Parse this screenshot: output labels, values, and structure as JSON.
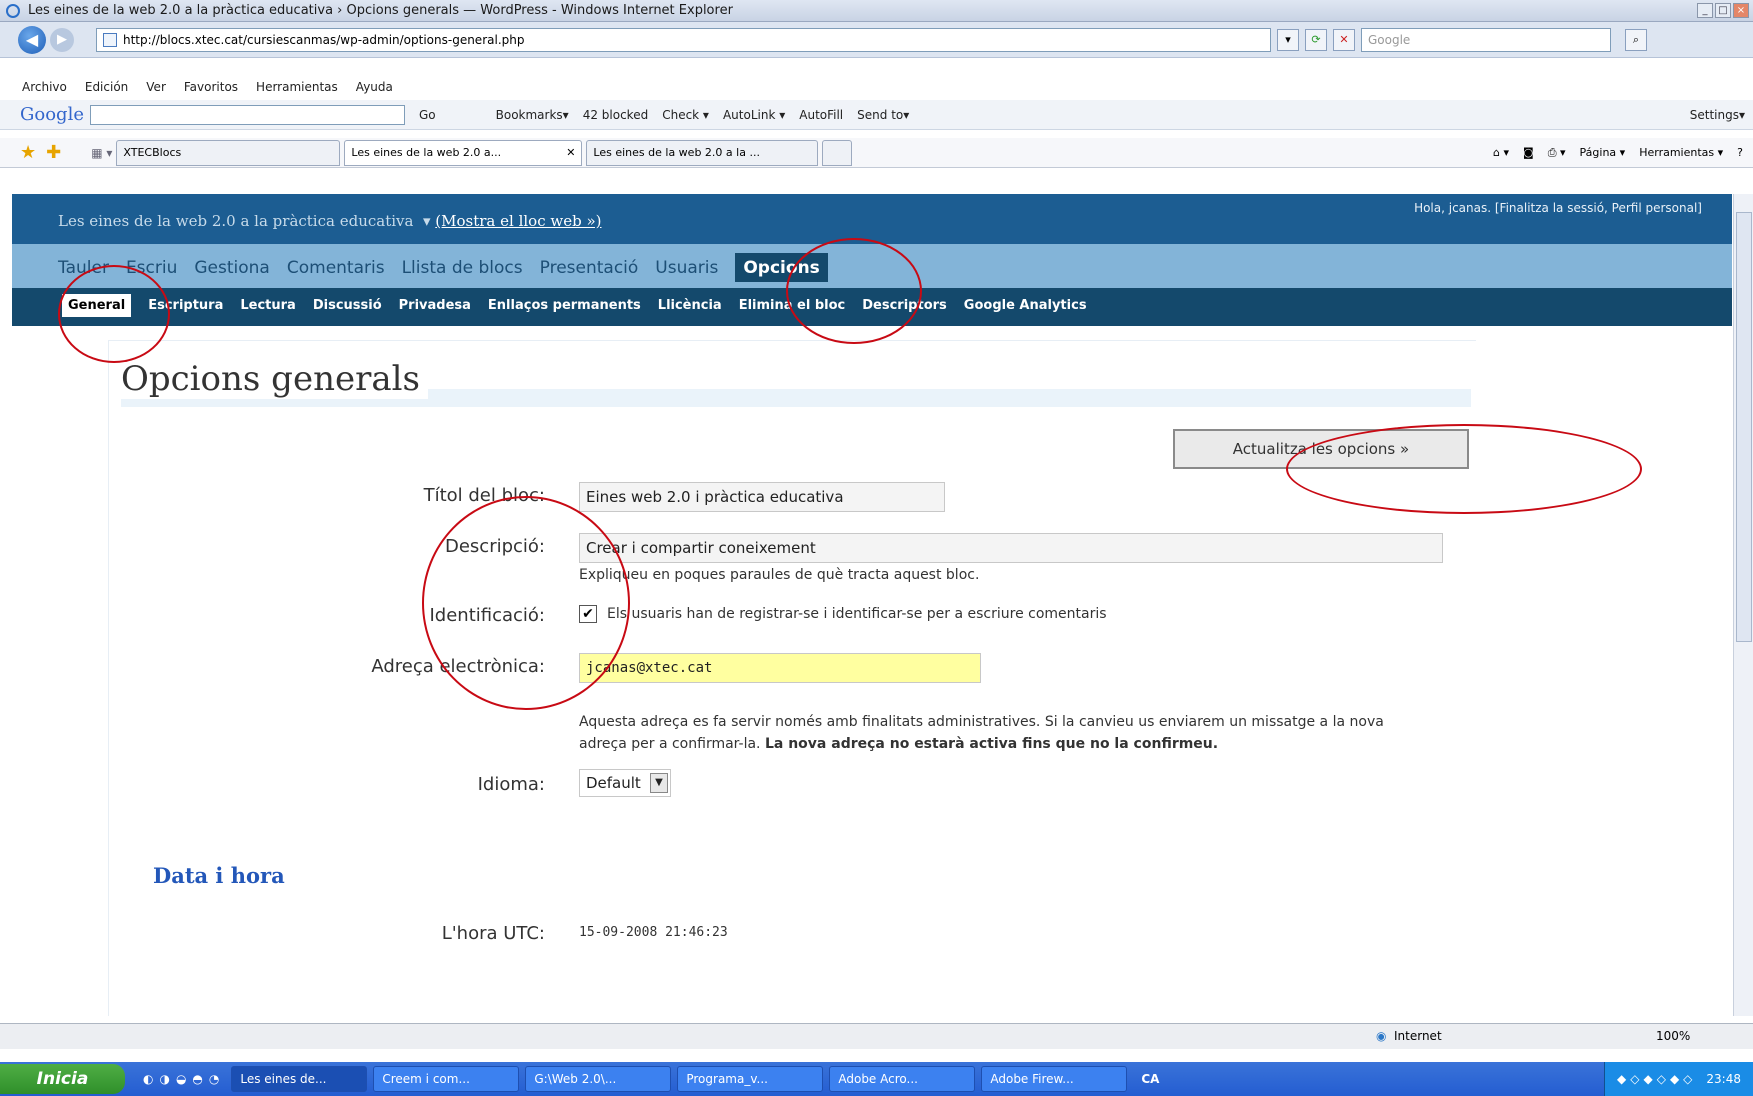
{
  "window": {
    "title": "Les eines de la web 2.0 a la pràctica educativa › Opcions generals — WordPress - Windows Internet Explorer"
  },
  "browser": {
    "url": "http://blocs.xtec.cat/cursiescanmas/wp-admin/options-general.php",
    "search_placeholder": "Google",
    "menu": [
      "Archivo",
      "Edición",
      "Ver",
      "Favoritos",
      "Herramientas",
      "Ayuda"
    ],
    "google_toolbar": {
      "logo": "Google",
      "items": [
        "Go",
        "Bookmarks▾",
        "42 blocked",
        "Check ▾",
        "AutoLink ▾",
        "AutoFill",
        "Send to▾",
        "Settings▾"
      ]
    },
    "tabs": [
      {
        "label": "XTECBlocs"
      },
      {
        "label": "Les eines de la web 2.0 a..."
      },
      {
        "label": "Les eines de la web 2.0 a la ..."
      }
    ],
    "tab_tools": [
      "Página ▾",
      "Herramientas ▾"
    ]
  },
  "wp": {
    "blog_name": "Les eines de la web 2.0 a la pràctica educativa",
    "view_site": "(Mostra el lloc web »)",
    "greeting": "Hola, jcanas. [Finalitza la sessió, Perfil personal]",
    "main_nav": [
      "Tauler",
      "Escriu",
      "Gestiona",
      "Comentaris",
      "Llista de blocs",
      "Presentació",
      "Usuaris"
    ],
    "main_nav_active": "Opcions",
    "sub_nav_active": "General",
    "sub_nav": [
      "Escriptura",
      "Lectura",
      "Discussió",
      "Privadesa",
      "Enllaços permanents",
      "Llicència",
      "Elimina el bloc",
      "Descriptors",
      "Google Analytics"
    ],
    "page_title": "Opcions generals",
    "update_button": "Actualitza les opcions »",
    "fields": {
      "title_label": "Títol del bloc:",
      "title_value": "Eines web 2.0 i pràctica educativa",
      "desc_label": "Descripció:",
      "desc_value": "Crear i compartir coneixement",
      "desc_hint": "Expliqueu en poques paraules de què tracta aquest bloc.",
      "ident_label": "Identificació:",
      "ident_text": "Els usuaris han de registrar-se i identificar-se per a escriure comentaris",
      "email_label": "Adreça electrònica:",
      "email_value": "jcanas@xtec.cat",
      "email_note1": "Aquesta adreça es fa servir només amb finalitats administratives. Si la canvieu us enviarem un missatge a la nova",
      "email_note2": "adreça per a confirmar-la.",
      "email_note_bold": "La nova adreça no estarà activa fins que no la confirmeu.",
      "lang_label": "Idioma:",
      "lang_value": "Default",
      "section_datetime": "Data i hora",
      "utc_label": "L'hora UTC:",
      "utc_value": "15-09-2008 21:46:23"
    }
  },
  "status": {
    "zone": "Internet",
    "zoom": "100%"
  },
  "taskbar": {
    "start": "Inicia",
    "items": [
      "Les eines de...",
      "Creem i com...",
      "G:\\Web 2.0\\...",
      "Programa_v...",
      "Adobe Acro...",
      "Adobe Firew..."
    ],
    "lang": "CA",
    "clock": "23:48"
  }
}
